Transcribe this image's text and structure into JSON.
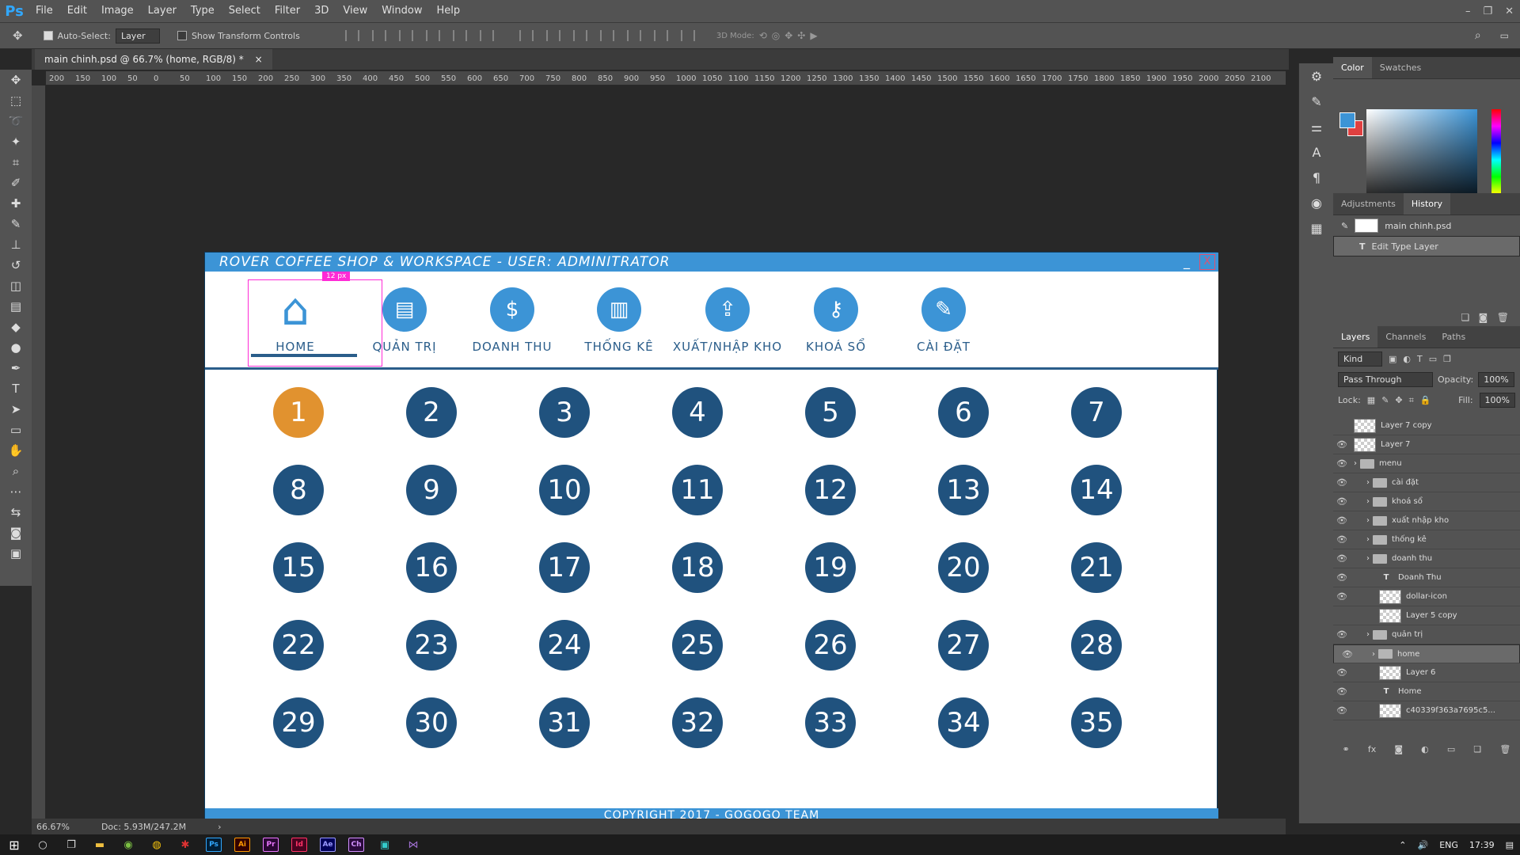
{
  "ps": {
    "logo": "Ps",
    "menu": [
      "File",
      "Edit",
      "Image",
      "Layer",
      "Type",
      "Select",
      "Filter",
      "3D",
      "View",
      "Window",
      "Help"
    ],
    "window_controls": [
      "–",
      "❐",
      "✕"
    ],
    "options": {
      "auto_select_label": "Auto-Select:",
      "auto_select_value": "Layer",
      "transform_label": "Show Transform Controls",
      "mode_3d": "3D Mode:"
    },
    "doc_tab": "main chinh.psd @ 66.7% (home, RGB/8) *",
    "ruler_ticks": [
      "200",
      "150",
      "100",
      "50",
      "0",
      "50",
      "100",
      "150",
      "200",
      "250",
      "300",
      "350",
      "400",
      "450",
      "500",
      "550",
      "600",
      "650",
      "700",
      "750",
      "800",
      "850",
      "900",
      "950",
      "1000",
      "1050",
      "1100",
      "1150",
      "1200",
      "1250",
      "1300",
      "1350",
      "1400",
      "1450",
      "1500",
      "1550",
      "1600",
      "1650",
      "1700",
      "1750",
      "1800",
      "1850",
      "1900",
      "1950",
      "2000",
      "2050",
      "2100"
    ],
    "status": {
      "zoom": "66.67%",
      "doc": "Doc: 5.93M/247.2M"
    },
    "selection_badge": "12 px"
  },
  "app": {
    "title": "ROVER COFFEE SHOP & WORKSPACE  -  USER: ADMINITRATOR",
    "minimize": "_",
    "close": "X",
    "nav": [
      {
        "label": "HOME",
        "icon": "home-icon",
        "glyph": "⌂"
      },
      {
        "label": "QUẢN TRỊ",
        "icon": "admin-icon",
        "glyph": "▤"
      },
      {
        "label": "DOANH THU",
        "icon": "dollar-icon",
        "glyph": "$"
      },
      {
        "label": "THỐNG KÊ",
        "icon": "bar-chart-icon",
        "glyph": "▥"
      },
      {
        "label": "XUẤT/NHẬP KHO",
        "icon": "upload-icon",
        "glyph": "⇪"
      },
      {
        "label": "KHOÁ SỔ",
        "icon": "key-icon",
        "glyph": "⚷"
      },
      {
        "label": "CÀI ĐẶT",
        "icon": "wrench-icon",
        "glyph": "✎"
      }
    ],
    "tables": [
      "1",
      "2",
      "3",
      "4",
      "5",
      "6",
      "7",
      "8",
      "9",
      "10",
      "11",
      "12",
      "13",
      "14",
      "15",
      "16",
      "17",
      "18",
      "19",
      "20",
      "21",
      "22",
      "23",
      "24",
      "25",
      "26",
      "27",
      "28",
      "29",
      "30",
      "31",
      "32",
      "33",
      "34",
      "35"
    ],
    "footer": "COPYRIGHT 2017  -  GOGOGO TEAM"
  },
  "panels": {
    "color_tabs": [
      "Color",
      "Swatches"
    ],
    "history_tabs": [
      "Adjustments",
      "History"
    ],
    "history": [
      {
        "label": "main chinh.psd",
        "kind": "snapshot"
      },
      {
        "label": "Edit Type Layer",
        "kind": "type"
      }
    ],
    "layer_tabs": [
      "Layers",
      "Channels",
      "Paths"
    ],
    "kind": "Kind",
    "blend": "Pass Through",
    "opacity_label": "Opacity:",
    "opacity": "100%",
    "lock_label": "Lock:",
    "fill_label": "Fill:",
    "fill": "100%",
    "layers": [
      {
        "name": "Layer 7 copy",
        "type": "pixel",
        "visible": false,
        "indent": 0
      },
      {
        "name": "Layer 7",
        "type": "pixel",
        "visible": true,
        "indent": 0
      },
      {
        "name": "menu",
        "type": "folder",
        "visible": true,
        "indent": 0
      },
      {
        "name": "cài đặt",
        "type": "folder",
        "visible": true,
        "indent": 1
      },
      {
        "name": "khoá sổ",
        "type": "folder",
        "visible": true,
        "indent": 1
      },
      {
        "name": "xuất nhập kho",
        "type": "folder",
        "visible": true,
        "indent": 1
      },
      {
        "name": "thống kê",
        "type": "folder",
        "visible": true,
        "indent": 1
      },
      {
        "name": "doanh thu",
        "type": "folder",
        "visible": true,
        "indent": 1
      },
      {
        "name": "Doanh Thu",
        "type": "text",
        "visible": true,
        "indent": 2
      },
      {
        "name": "dollar-icon",
        "type": "pixel",
        "visible": true,
        "indent": 2
      },
      {
        "name": "Layer 5 copy",
        "type": "pixel",
        "visible": false,
        "indent": 2
      },
      {
        "name": "quản trị",
        "type": "folder",
        "visible": true,
        "indent": 1
      },
      {
        "name": "home",
        "type": "folder",
        "visible": true,
        "indent": 1,
        "selected": true
      },
      {
        "name": "Layer 6",
        "type": "pixel",
        "visible": true,
        "indent": 2
      },
      {
        "name": "Home",
        "type": "text",
        "visible": true,
        "indent": 2
      },
      {
        "name": "c40339f363a7695c5...",
        "type": "pixel",
        "visible": true,
        "indent": 2
      }
    ],
    "layer_bottom": [
      "⚭",
      "fx",
      "◙",
      "◐",
      "▭",
      "❏",
      "🗑"
    ]
  },
  "taskbar": {
    "apps": [
      {
        "label": "Ps",
        "bg": "#001e36",
        "fg": "#31a8ff"
      },
      {
        "label": "Ai",
        "bg": "#330000",
        "fg": "#ff9a00"
      },
      {
        "label": "Pr",
        "bg": "#2a0634",
        "fg": "#ea77ff"
      },
      {
        "label": "Id",
        "bg": "#49021f",
        "fg": "#ff3366"
      },
      {
        "label": "Ae",
        "bg": "#00005b",
        "fg": "#9999ff"
      },
      {
        "label": "Ch",
        "bg": "#2b0a3d",
        "fg": "#d291ff"
      }
    ],
    "lang": "ENG",
    "time": "17:39"
  },
  "colors": {
    "accent": "#3c94d6",
    "tab": "#20527e",
    "active_tab": "#e1922f",
    "nav_text": "#2a5d8a",
    "selection": "#ff2bd6"
  }
}
